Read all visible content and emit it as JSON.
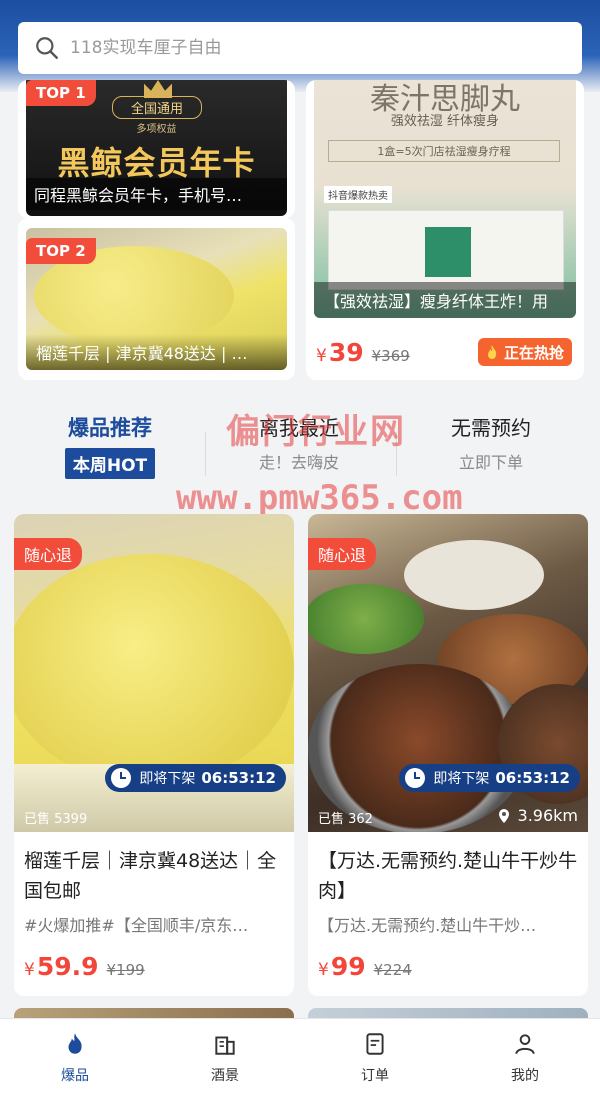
{
  "search": {
    "placeholder": "118实现车厘子自由"
  },
  "top_left_cards": [
    {
      "rank": "TOP 1",
      "image_lines": [
        "全国通用",
        "多项权益",
        "黑鲸会员年卡"
      ],
      "caption": "同程黑鲸会员年卡，手机号…"
    },
    {
      "rank": "TOP 2",
      "caption": "榴莲千层 | 津京冀48送达 | …"
    }
  ],
  "top_right_card": {
    "image_lines": [
      "秦汁思脚丸",
      "强效祛湿 纤体瘦身",
      "1盒=5次门店祛湿瘦身疗程",
      "抖音爆款热卖"
    ],
    "caption": "【强效祛湿】瘦身纤体王炸！用",
    "price": {
      "currency": "¥",
      "value": "39",
      "original": "¥369"
    },
    "hot_badge": "正在热抢"
  },
  "mid_tabs": [
    {
      "title": "爆品推荐",
      "sub": "本周HOT"
    },
    {
      "title": "离我最近",
      "sub": "走！去嗨皮"
    },
    {
      "title": "无需预约",
      "sub": "立即下单"
    }
  ],
  "watermark": {
    "line1": "偏门行业网",
    "line2": "www.pmw365.com"
  },
  "products": [
    {
      "badge": "随心退",
      "timer_label": "即将下架",
      "timer_time": "06:53:12",
      "sold": "已售 5399",
      "title": "榴莲千层｜津京冀48送达｜全国包邮",
      "desc": "#火爆加推#【全国顺丰/京东…",
      "currency": "¥",
      "price": "59.9",
      "original": "¥199"
    },
    {
      "badge": "随心退",
      "timer_label": "即将下架",
      "timer_time": "06:53:12",
      "sold": "已售 362",
      "distance": "3.96km",
      "title": "【万达.无需预约.楚山牛干炒牛肉】",
      "desc": "【万达.无需预约.楚山牛干炒…",
      "currency": "¥",
      "price": "99",
      "original": "¥224"
    }
  ],
  "tabbar": [
    {
      "label": "爆品",
      "icon": "flame-icon"
    },
    {
      "label": "酒景",
      "icon": "building-icon"
    },
    {
      "label": "订单",
      "icon": "order-icon"
    },
    {
      "label": "我的",
      "icon": "user-icon"
    }
  ],
  "colors": {
    "brand": "#1d4c9c",
    "accent": "#f24d3a",
    "price": "#f2463a"
  }
}
